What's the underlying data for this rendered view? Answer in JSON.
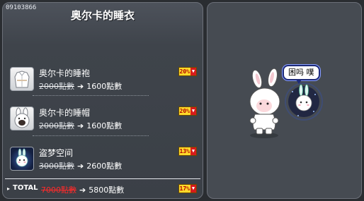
{
  "panel": {
    "id": "09103866",
    "title": "奥尔卡的睡衣"
  },
  "items": [
    {
      "name": "奥尔卡的睡袍",
      "old_price": "2000點數",
      "arrow": "➔",
      "new_price": "1600點數",
      "discount": "20%",
      "thumb_icon": "pajama-robe-icon"
    },
    {
      "name": "奥尔卡的睡帽",
      "old_price": "2000點數",
      "arrow": "➔",
      "new_price": "1600點數",
      "discount": "20%",
      "thumb_icon": "pajama-hat-icon"
    },
    {
      "name": "盗梦空间",
      "old_price": "3000點數",
      "arrow": "➔",
      "new_price": "2600點數",
      "discount": "13%",
      "thumb_icon": "dream-pet-icon"
    }
  ],
  "total": {
    "label": "TOTAL",
    "old_price": "7000點數",
    "arrow": "➔",
    "new_price": "5800點數",
    "discount": "17%"
  },
  "preview": {
    "speech_text": "困吗 噗"
  },
  "colors": {
    "panel_bg": "#3f444b",
    "badge_yellow": "#ffd92a",
    "badge_red": "#d71b1b",
    "total_old_price": "#ff2a2a"
  }
}
